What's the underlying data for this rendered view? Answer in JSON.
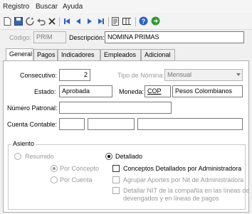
{
  "menu": [
    "Registro",
    "Buscar",
    "Ayuda"
  ],
  "toolbar": {
    "icons": [
      "new-icon",
      "save-icon",
      "refresh-icon",
      "undo-icon",
      "delete-icon",
      "first-icon",
      "prev-icon",
      "next-icon",
      "last-icon",
      "report-icon",
      "columns-icon",
      "help-icon",
      "exit-icon"
    ]
  },
  "header": {
    "codigo_label": "Código:",
    "codigo_value": "PRIM",
    "descripcion_label": "Descripción:",
    "descripcion_value": "NOMINA PRIMAS"
  },
  "tabs": [
    "General",
    "Pagos",
    "Indicadores",
    "Empleados",
    "Adicional"
  ],
  "general": {
    "consecutivo_label": "Consecutivo:",
    "consecutivo_value": "2",
    "tipo_label": "Tipo de Nómina:",
    "tipo_value": "Mensual",
    "estado_label": "Estado:",
    "estado_value": "Aprobada",
    "moneda_label": "Moneda:",
    "moneda_code": "COP",
    "moneda_name": "Pesos Colombianos",
    "patronal_label": "Número Patronal:",
    "contable_label": "Cuenta Contable:"
  },
  "asiento": {
    "title": "Asiento",
    "resumido": "Resumido",
    "detallado": "Detallado",
    "por_concepto": "Por Concepto",
    "por_cuenta": "Por Cuenta",
    "conceptos_admin": "Conceptos Detallados por Administradora",
    "agrupar": "Agrupar Aportes por Nit de Administradora",
    "detallar_1": "Detallar NIT de la compañía en las líneas de",
    "detallar_2": "devengados y en líneas de pagos"
  },
  "colors": {
    "accent_blue": "#1f5fbf",
    "green": "#2f9a2f"
  }
}
